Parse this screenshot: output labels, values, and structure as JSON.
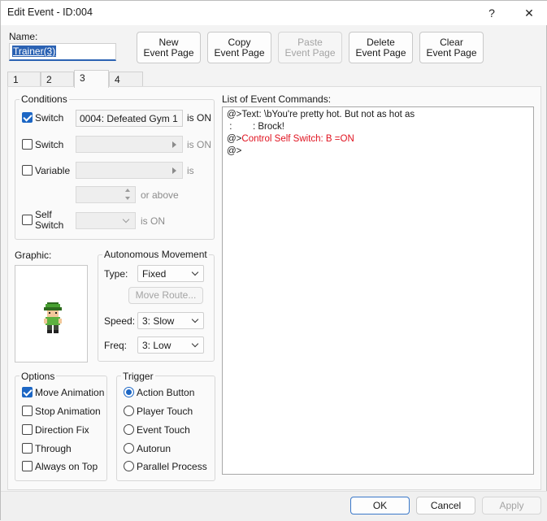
{
  "window": {
    "title": "Edit Event - ID:004",
    "help_symbol": "?",
    "close_symbol": "✕"
  },
  "name": {
    "label": "Name:",
    "value": "Trainer(3)"
  },
  "page_buttons": {
    "new_page": [
      "New",
      "Event Page"
    ],
    "copy_page": [
      "Copy",
      "Event Page"
    ],
    "paste_page": [
      "Paste",
      "Event Page"
    ],
    "delete_page": [
      "Delete",
      "Event Page"
    ],
    "clear_page": [
      "Clear",
      "Event Page"
    ]
  },
  "tabs": [
    {
      "label": "1",
      "active": false
    },
    {
      "label": "2",
      "active": false
    },
    {
      "label": "3",
      "active": true
    },
    {
      "label": "4",
      "active": false
    }
  ],
  "conditions": {
    "legend": "Conditions",
    "switch1": {
      "label": "Switch",
      "checked": true,
      "value": "0004: Defeated Gym 1",
      "suffix": "is ON"
    },
    "switch2": {
      "label": "Switch",
      "checked": false,
      "value": "",
      "suffix": "is ON"
    },
    "variable": {
      "label": "Variable",
      "checked": false,
      "value": "",
      "suffix": "is"
    },
    "variable_min": {
      "value": "",
      "suffix": "or above"
    },
    "self_switch": {
      "label_line1": "Self",
      "label_line2": "Switch",
      "checked": false,
      "value": "",
      "suffix": "is ON"
    }
  },
  "graphic": {
    "label": "Graphic:",
    "sprite": "green-cap-trainer-sprite"
  },
  "autonomous_movement": {
    "legend": "Autonomous Movement",
    "type_label": "Type:",
    "type_value": "Fixed",
    "move_route_button": "Move Route...",
    "speed_label": "Speed:",
    "speed_value": "3: Slow",
    "freq_label": "Freq:",
    "freq_value": "3: Low"
  },
  "options": {
    "legend": "Options",
    "items": [
      {
        "label": "Move Animation",
        "checked": true
      },
      {
        "label": "Stop Animation",
        "checked": false
      },
      {
        "label": "Direction Fix",
        "checked": false
      },
      {
        "label": "Through",
        "checked": false
      },
      {
        "label": "Always on Top",
        "checked": false
      }
    ]
  },
  "trigger": {
    "legend": "Trigger",
    "items": [
      {
        "label": "Action Button",
        "selected": true
      },
      {
        "label": "Player Touch",
        "selected": false
      },
      {
        "label": "Event Touch",
        "selected": false
      },
      {
        "label": "Autorun",
        "selected": false
      },
      {
        "label": "Parallel Process",
        "selected": false
      }
    ]
  },
  "event_commands": {
    "label": "List of Event Commands:",
    "lines": [
      {
        "text": "@>Text: \\bYou're pretty hot. But not as hot as",
        "color": "#1a1a1a"
      },
      {
        "text": " :        : Brock!",
        "color": "#1a1a1a"
      },
      {
        "prefix": "@>",
        "text": "Control Self Switch: B =ON",
        "color": "#e0121f"
      },
      {
        "text": "@>",
        "color": "#1a1a1a"
      }
    ]
  },
  "footer": {
    "ok": "OK",
    "cancel": "Cancel",
    "apply": "Apply"
  },
  "colors": {
    "accent": "#1c66c4",
    "command_red": "#e0121f"
  }
}
